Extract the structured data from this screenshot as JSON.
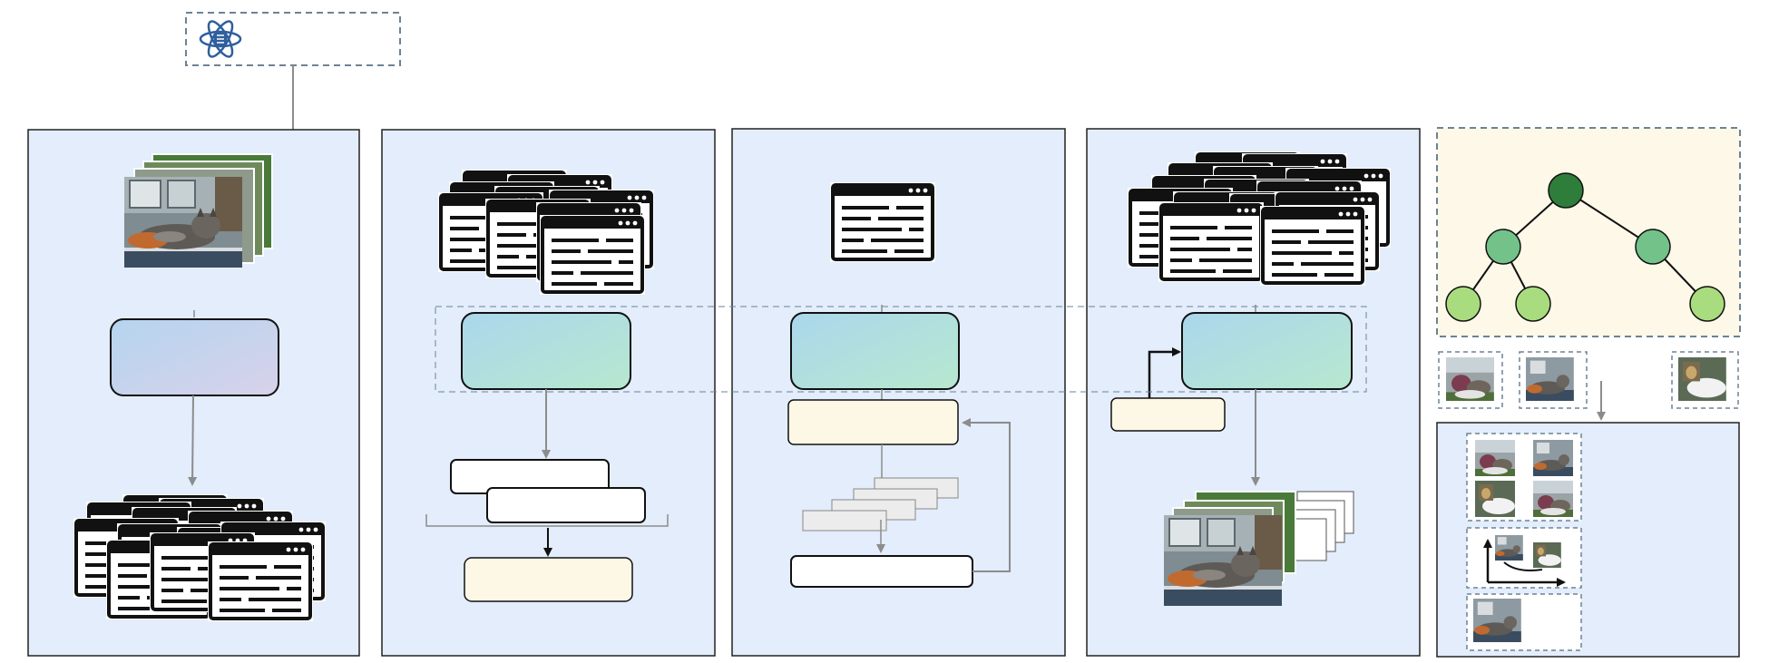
{
  "diagram": {
    "panels": [
      {
        "id": "panel-1",
        "label": ""
      },
      {
        "id": "panel-2",
        "label": ""
      },
      {
        "id": "panel-3",
        "label": ""
      },
      {
        "id": "panel-4",
        "label": ""
      },
      {
        "id": "panel-5",
        "label": ""
      }
    ],
    "source_box": {
      "label": "",
      "icon": "atom-document-icon"
    },
    "tree": {
      "levels": 3,
      "nodes": 6
    },
    "colors": {
      "panel_bg": "#e3edfb",
      "panel_border": "#222222",
      "dashed": "#6b8396",
      "tree_bg": "#fdf8e8",
      "node_dark": "#2e7d3a",
      "node_mid": "#72c28a",
      "node_light": "#a9dc7e",
      "cream_box": "#fdf8e6",
      "arrow": "#8c8c8c"
    }
  }
}
